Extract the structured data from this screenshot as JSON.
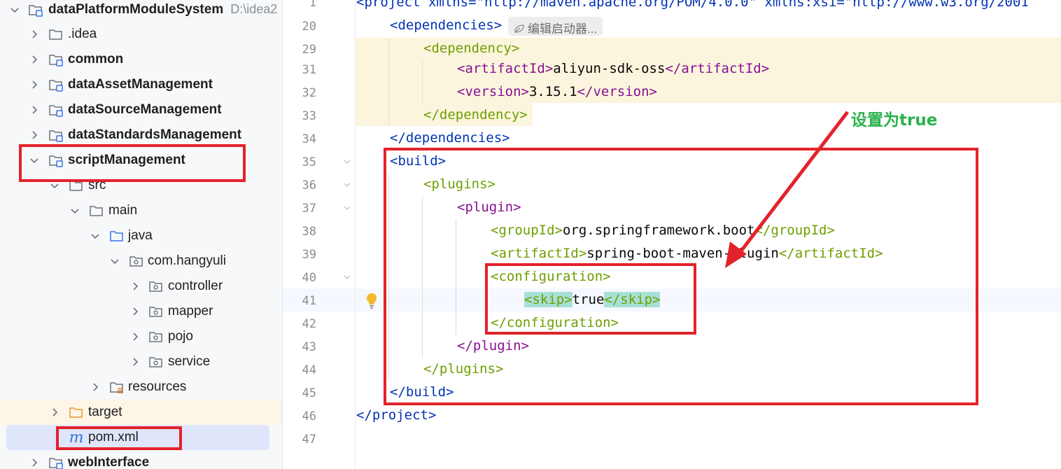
{
  "project_tree": {
    "root": {
      "name": "dataPlatformModuleSystem",
      "path": "D:\\idea2"
    },
    "items": [
      {
        "label": ".idea"
      },
      {
        "label": "common"
      },
      {
        "label": "dataAssetManagement"
      },
      {
        "label": "dataSourceManagement"
      },
      {
        "label": "dataStandardsManagement"
      },
      {
        "label": "scriptManagement"
      },
      {
        "label": "src"
      },
      {
        "label": "main"
      },
      {
        "label": "java"
      },
      {
        "label": "com.hangyuli"
      },
      {
        "label": "controller"
      },
      {
        "label": "mapper"
      },
      {
        "label": "pojo"
      },
      {
        "label": "service"
      },
      {
        "label": "resources"
      },
      {
        "label": "target"
      },
      {
        "label": "pom.xml",
        "icon_glyph": "m"
      },
      {
        "label": "webInterface"
      }
    ]
  },
  "editor": {
    "inlay_hint": "编辑启动器...",
    "lines": [
      {
        "num": "1",
        "text": "<project xmlns=\"http://maven.apache.org/POM/4.0.0\" xmlns:xsi=\"http://www.w3.org/2001"
      },
      {
        "num": "20",
        "text": "<dependencies>"
      },
      {
        "num": "29",
        "text": "<dependency>"
      },
      {
        "num": "31",
        "open": "<artifactId>",
        "value": "aliyun-sdk-oss",
        "close": "</artifactId>"
      },
      {
        "num": "32",
        "open": "<version>",
        "value": "3.15.1",
        "close": "</version>"
      },
      {
        "num": "33",
        "text": "</dependency>"
      },
      {
        "num": "34",
        "text": "</dependencies>"
      },
      {
        "num": "35",
        "text": "<build>"
      },
      {
        "num": "36",
        "text": "<plugins>"
      },
      {
        "num": "37",
        "text": "<plugin>"
      },
      {
        "num": "38",
        "open": "<groupId>",
        "value": "org.springframework.boot",
        "close": "</groupId>"
      },
      {
        "num": "39",
        "open": "<artifactId>",
        "value": "spring-boot-maven-plugin",
        "close": "</artifactId>"
      },
      {
        "num": "40",
        "text": "<configuration>"
      },
      {
        "num": "41",
        "open": "<skip>",
        "value": "true",
        "close": "</skip>"
      },
      {
        "num": "42",
        "text": "</configuration>"
      },
      {
        "num": "43",
        "text": "</plugin>"
      },
      {
        "num": "44",
        "text": "</plugins>"
      },
      {
        "num": "45",
        "text": "</build>"
      },
      {
        "num": "46",
        "text": "</project>"
      },
      {
        "num": "47",
        "text": ""
      }
    ]
  },
  "annotation": {
    "text": "设置为true",
    "box_color": "#e3222b",
    "text_color": "#2bb24c"
  },
  "colors": {
    "tag_blue": "#0033b3",
    "tag_purple": "#871094",
    "tag_green": "#6c9f00",
    "string_green": "#067d17"
  }
}
